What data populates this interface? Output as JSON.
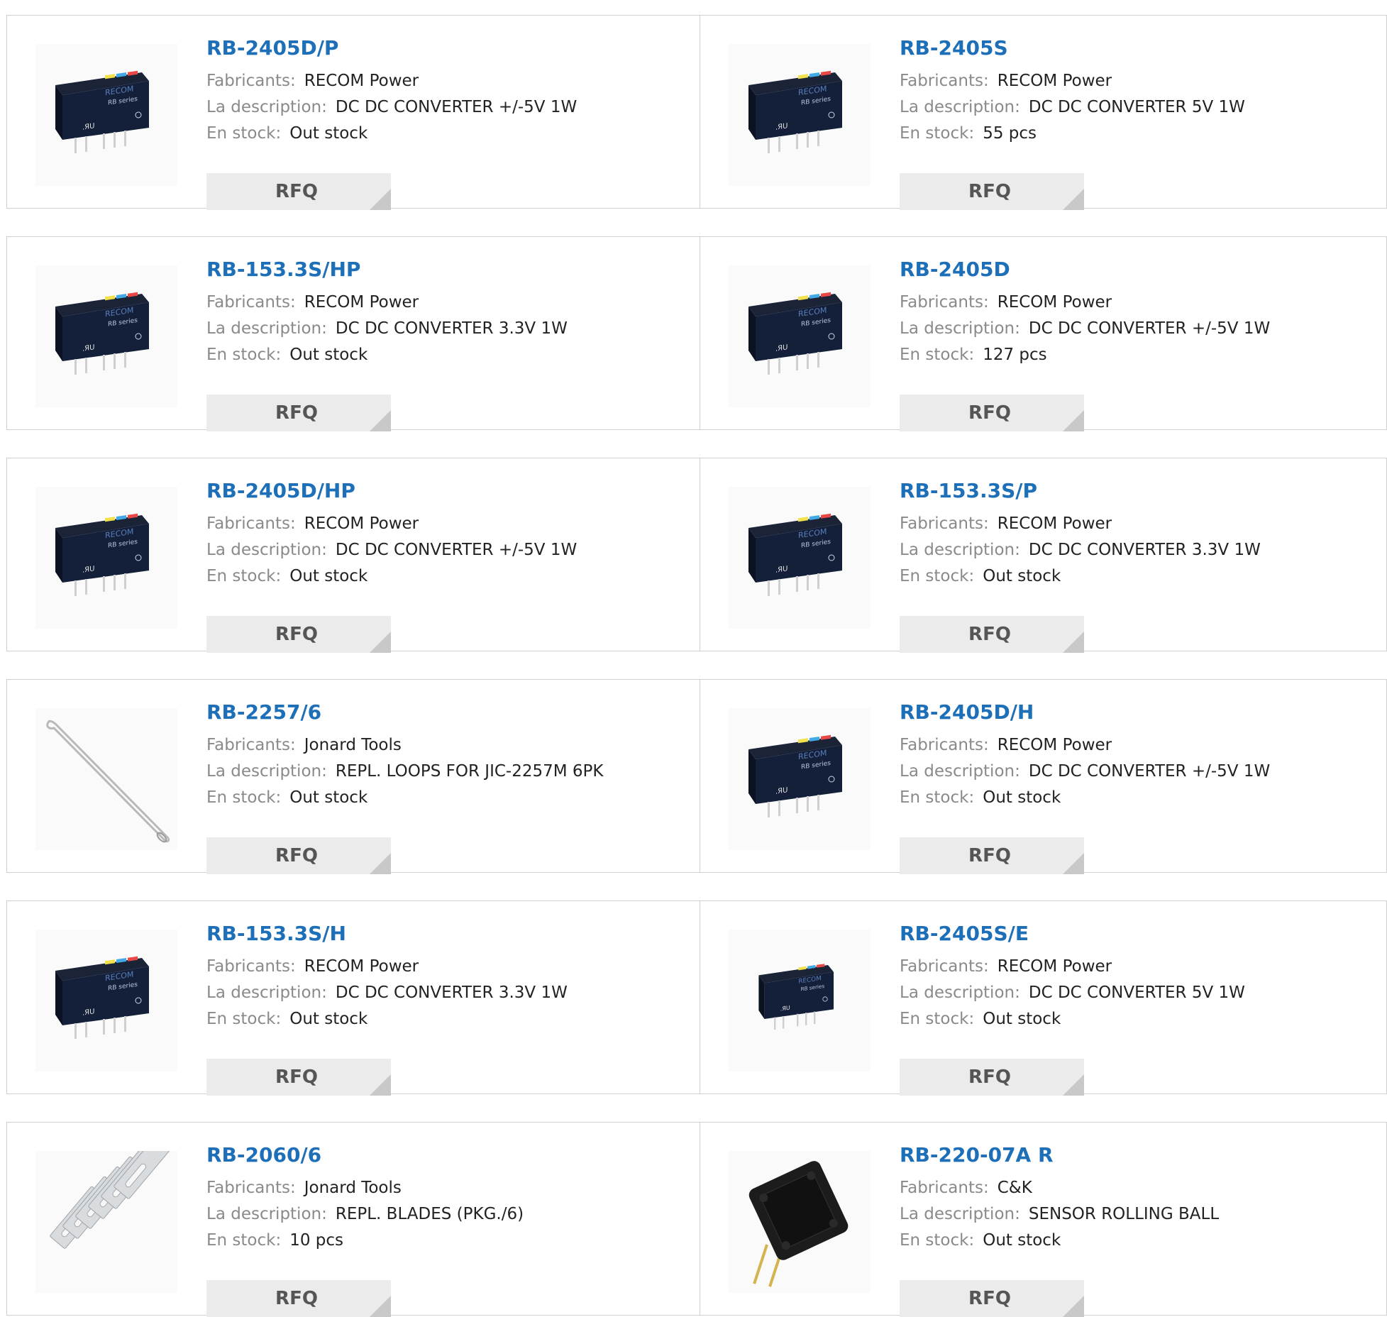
{
  "labels": {
    "manufacturer": "Fabricants:",
    "description": "La description:",
    "stock": "En stock:",
    "rfq": "RFQ"
  },
  "products": [
    {
      "part": "RB-2405D/P",
      "manufacturer": "RECOM Power",
      "description": "DC DC CONVERTER +/-5V 1W",
      "stock": "Out stock",
      "image": "recom-rb-module"
    },
    {
      "part": "RB-2405S",
      "manufacturer": "RECOM Power",
      "description": "DC DC CONVERTER 5V 1W",
      "stock": "55 pcs",
      "image": "recom-rb-module"
    },
    {
      "part": "RB-153.3S/HP",
      "manufacturer": "RECOM Power",
      "description": "DC DC CONVERTER 3.3V 1W",
      "stock": "Out stock",
      "image": "recom-rb-module"
    },
    {
      "part": "RB-2405D",
      "manufacturer": "RECOM Power",
      "description": "DC DC CONVERTER +/-5V 1W",
      "stock": "127 pcs",
      "image": "recom-rb-module"
    },
    {
      "part": "RB-2405D/HP",
      "manufacturer": "RECOM Power",
      "description": "DC DC CONVERTER +/-5V 1W",
      "stock": "Out stock",
      "image": "recom-rb-module"
    },
    {
      "part": "RB-153.3S/P",
      "manufacturer": "RECOM Power",
      "description": "DC DC CONVERTER 3.3V 1W",
      "stock": "Out stock",
      "image": "recom-rb-module"
    },
    {
      "part": "RB-2257/6",
      "manufacturer": "Jonard Tools",
      "description": "REPL. LOOPS FOR JIC-2257M 6PK",
      "stock": "Out stock",
      "image": "wire-loop"
    },
    {
      "part": "RB-2405D/H",
      "manufacturer": "RECOM Power",
      "description": "DC DC CONVERTER +/-5V 1W",
      "stock": "Out stock",
      "image": "recom-rb-module"
    },
    {
      "part": "RB-153.3S/H",
      "manufacturer": "RECOM Power",
      "description": "DC DC CONVERTER 3.3V 1W",
      "stock": "Out stock",
      "image": "recom-rb-module"
    },
    {
      "part": "RB-2405S/E",
      "manufacturer": "RECOM Power",
      "description": "DC DC CONVERTER 5V 1W",
      "stock": "Out stock",
      "image": "recom-rb-module-small"
    },
    {
      "part": "RB-2060/6",
      "manufacturer": "Jonard Tools",
      "description": "REPL. BLADES (PKG./6)",
      "stock": "10 pcs",
      "image": "blade-pack"
    },
    {
      "part": "RB-220-07A R",
      "manufacturer": "C&K",
      "description": "SENSOR ROLLING BALL",
      "stock": "Out stock",
      "image": "rolling-ball-sensor"
    }
  ]
}
